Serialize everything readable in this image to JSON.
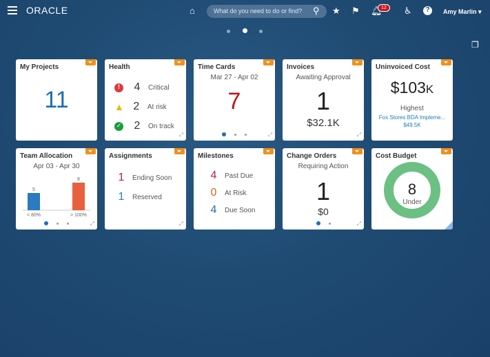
{
  "header": {
    "logo": "ORACLE",
    "search_placeholder": "What do you need to do or find?",
    "notifications": "12",
    "user": "Amy Marlin"
  },
  "tiles": {
    "projects": {
      "title": "My Projects",
      "value": "11"
    },
    "health": {
      "title": "Health",
      "items": [
        {
          "n": "4",
          "label": "Critical"
        },
        {
          "n": "2",
          "label": "At risk"
        },
        {
          "n": "2",
          "label": "On track"
        }
      ]
    },
    "timecards": {
      "title": "Time Cards",
      "range": "Mar 27 - Apr 02",
      "value": "7"
    },
    "invoices": {
      "title": "Invoices",
      "sub": "Awaiting Approval",
      "value": "1",
      "amount": "$32.1K"
    },
    "uninvoiced": {
      "title": "Uninvoiced Cost",
      "value": "$103",
      "unit": "K",
      "highest": "Highest",
      "project": "Fox Stores BDA Impleme...",
      "project_amount": "$49.5K"
    },
    "team": {
      "title": "Team Allocation",
      "range": "Apr 03 - Apr 30"
    },
    "assignments": {
      "title": "Assignments",
      "items": [
        {
          "n": "1",
          "label": "Ending Soon"
        },
        {
          "n": "1",
          "label": "Reserved"
        }
      ]
    },
    "milestones": {
      "title": "Milestones",
      "items": [
        {
          "n": "4",
          "label": "Past Due"
        },
        {
          "n": "0",
          "label": "At Risk"
        },
        {
          "n": "4",
          "label": "Due Soon"
        }
      ]
    },
    "changeorders": {
      "title": "Change Orders",
      "sub": "Requiring Action",
      "value": "1",
      "amount": "$0"
    },
    "costbudget": {
      "title": "Cost Budget",
      "value": "8",
      "label": "Under"
    }
  },
  "chart_data": {
    "type": "bar",
    "categories": [
      "< 80%",
      "> 100%"
    ],
    "values": [
      5,
      8
    ],
    "colors": [
      "#2a7bbf",
      "#e8603c"
    ]
  }
}
